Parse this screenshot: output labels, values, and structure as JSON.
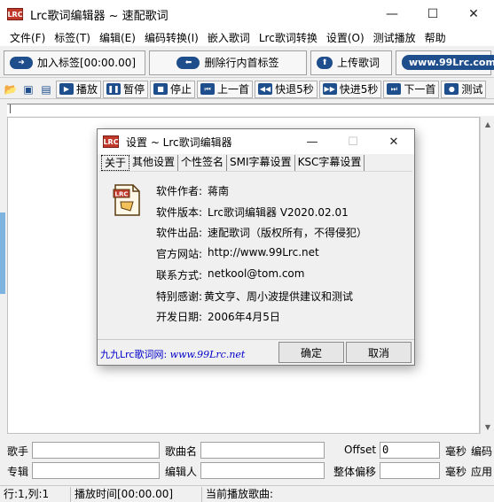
{
  "window": {
    "title": "Lrc歌词编辑器 ~ 速配歌词",
    "icon": "lrc-app-icon"
  },
  "menu": [
    "文件(F)",
    "标签(T)",
    "编辑(E)",
    "编码转换(I)",
    "嵌入歌词",
    "Lrc歌词转换",
    "设置(O)",
    "测试播放",
    "帮助"
  ],
  "toolbar1": {
    "add_tag": "加入标签[00:00.00]",
    "delete_tag": "删除行内首标签",
    "upload": "上传歌词",
    "url": "www.99Lrc.com"
  },
  "toolbar2": {
    "play": "播放",
    "pause": "暂停",
    "stop": "停止",
    "first": "上一首",
    "rewind": "快退5秒",
    "forward": "快进5秒",
    "next": "下一首",
    "test": "测试"
  },
  "fields": {
    "singer_label": "歌手",
    "singer_value": "",
    "song_label": "歌曲名",
    "song_value": "",
    "offset_label": "Offset",
    "offset_value": "0",
    "ms1": "毫秒",
    "encoding": "编码",
    "album_label": "专辑",
    "album_value": "",
    "editor_label": "编辑人",
    "editor_value": "",
    "shift_label": "整体偏移",
    "shift_value": "",
    "ms2": "毫秒",
    "apply": "应用"
  },
  "status": {
    "pos": "行:1,列:1",
    "time": "播放时间[00:00.00]",
    "current": "当前播放歌曲:"
  },
  "dialog": {
    "title": "设置 ~ Lrc歌词编辑器",
    "tabs": [
      "关于",
      "其他设置",
      "个性签名",
      "SMI字幕设置",
      "KSC字幕设置"
    ],
    "rows": [
      {
        "label": "软件作者:",
        "value": "蒋南"
      },
      {
        "label": "软件版本:",
        "value": "Lrc歌词编辑器 V2020.02.01"
      },
      {
        "label": "软件出品:",
        "value": "速配歌词（版权所有，不得侵犯）"
      },
      {
        "label": "官方网站:",
        "value": "http://www.99Lrc.net"
      },
      {
        "label": "联系方式:",
        "value": "netkool@tom.com"
      },
      {
        "label": "特别感谢:",
        "value": "黄文亨、周小波提供建议和测试"
      },
      {
        "label": "开发日期:",
        "value": "2006年4月5日"
      }
    ],
    "link_text": "九九Lrc歌词网:",
    "link_url": "www.99Lrc.net",
    "ok": "确定",
    "cancel": "取消"
  }
}
